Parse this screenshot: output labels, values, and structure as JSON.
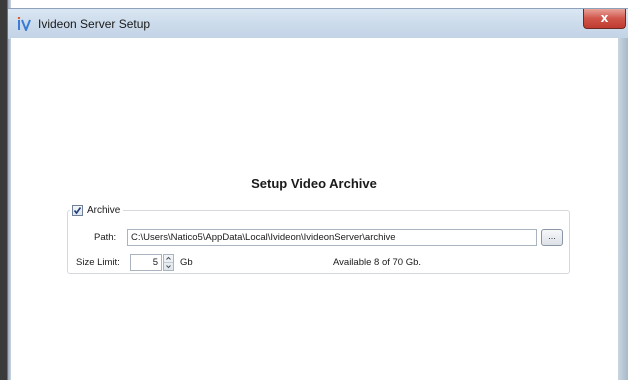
{
  "window": {
    "title": "Ivideon Server Setup",
    "close_label": "x"
  },
  "heading": "Setup Video Archive",
  "archive": {
    "checkbox_label": "Archive",
    "checked": true,
    "path_label": "Path:",
    "path_value": "C:\\Users\\Natico5\\AppData\\Local\\Ivideon\\IvideonServer\\archive",
    "browse_label": "...",
    "size_label": "Size Limit:",
    "size_value": "5",
    "size_unit": "Gb",
    "available_text": "Available 8 of 70 Gb."
  },
  "colors": {
    "accent_close": "#c03a30",
    "titlebar": "#cddcec"
  },
  "icons": {
    "app": "ivideon-app-icon",
    "check": "check-icon",
    "up": "chevron-up-icon",
    "down": "chevron-down-icon"
  }
}
